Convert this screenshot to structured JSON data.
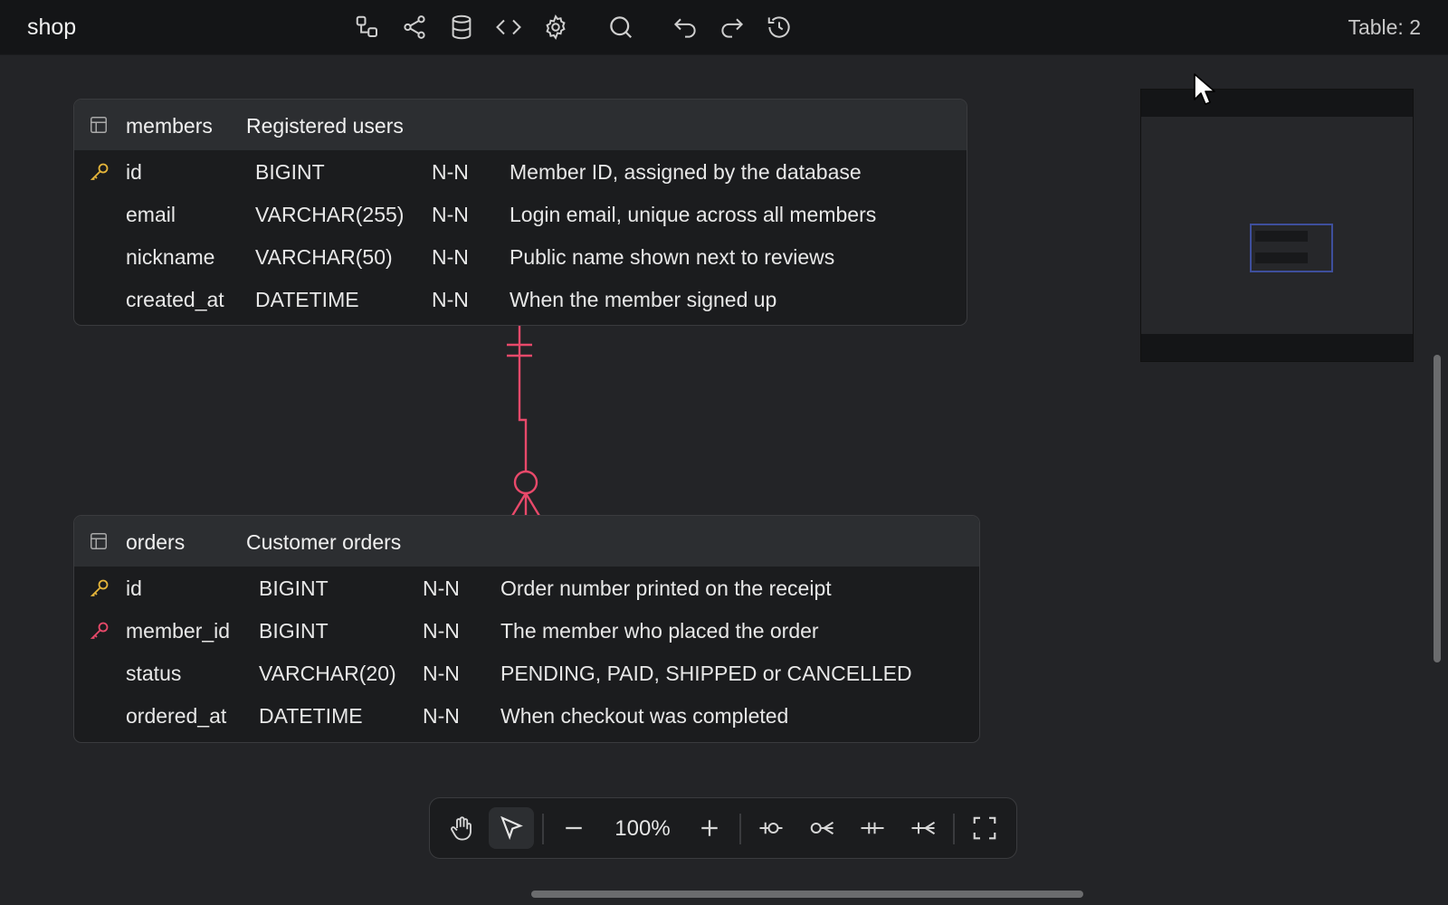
{
  "header": {
    "title": "shop",
    "table_count": "Table: 2",
    "tools": [
      {
        "icon": "relationship-icon"
      },
      {
        "icon": "share-icon"
      },
      {
        "icon": "database-icon"
      },
      {
        "icon": "code-icon"
      },
      {
        "icon": "gear-icon"
      },
      {
        "icon": "search-icon"
      },
      {
        "icon": "undo-icon"
      },
      {
        "icon": "redo-icon"
      },
      {
        "icon": "history-icon"
      }
    ]
  },
  "tables": [
    {
      "name": "members",
      "description": "Registered users",
      "columns": [
        {
          "name": "id",
          "type": "BIGINT",
          "nullability": "N-N",
          "comment": "Member ID, assigned by the database",
          "key": "primary"
        },
        {
          "name": "email",
          "type": "VARCHAR(255)",
          "nullability": "N-N",
          "comment": "Login email, unique across all members",
          "key": ""
        },
        {
          "name": "nickname",
          "type": "VARCHAR(50)",
          "nullability": "N-N",
          "comment": "Public name shown next to reviews",
          "key": ""
        },
        {
          "name": "created_at",
          "type": "DATETIME",
          "nullability": "N-N",
          "comment": "When the member signed up",
          "key": ""
        }
      ]
    },
    {
      "name": "orders",
      "description": "Customer orders",
      "columns": [
        {
          "name": "id",
          "type": "BIGINT",
          "nullability": "N-N",
          "comment": "Order number printed on the receipt",
          "key": "primary"
        },
        {
          "name": "member_id",
          "type": "BIGINT",
          "nullability": "N-N",
          "comment": "The member who placed the order",
          "key": "foreign"
        },
        {
          "name": "status",
          "type": "VARCHAR(20)",
          "nullability": "N-N",
          "comment": "PENDING, PAID, SHIPPED or CANCELLED",
          "key": ""
        },
        {
          "name": "ordered_at",
          "type": "DATETIME",
          "nullability": "N-N",
          "comment": "When checkout was completed",
          "key": ""
        }
      ]
    }
  ],
  "relationship": {
    "from": "members",
    "to": "orders",
    "from_cardinality": "one-and-only-one",
    "to_cardinality": "zero-or-many"
  },
  "toolbar": {
    "zoom": "100%",
    "tools": [
      {
        "icon": "hand-icon"
      },
      {
        "icon": "pointer-icon",
        "active": true
      },
      {
        "icon": "zoom-out-icon"
      },
      {
        "icon": "zoom-in-icon"
      },
      {
        "icon": "one-to-zero-icon"
      },
      {
        "icon": "zero-or-many-icon"
      },
      {
        "icon": "one-to-one-icon"
      },
      {
        "icon": "one-or-many-icon"
      },
      {
        "icon": "fullscreen-icon"
      }
    ]
  },
  "colors": {
    "background": "#232427",
    "header_bar": "#141517",
    "table_header": "#2c2e31",
    "relationship_line": "#e8496a",
    "primary_key": "#e5b53a",
    "foreign_key": "#e8496a",
    "minimap_viewport": "#3e4f9c"
  }
}
